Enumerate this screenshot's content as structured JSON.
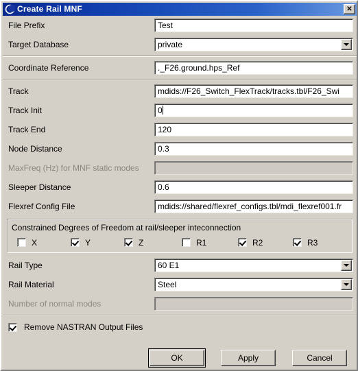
{
  "window": {
    "title": "Create Rail MNF",
    "icon": "moon-icon",
    "close_label": "✕",
    "close_icon": "close-icon"
  },
  "form": {
    "groups": [
      {
        "rows": [
          {
            "label": "File Prefix",
            "type": "text",
            "value": "Test",
            "disabled": false,
            "focused": false
          },
          {
            "label": "Target Database",
            "type": "combo",
            "value": "private",
            "disabled": false
          }
        ]
      },
      {
        "rows": [
          {
            "label": "Coordinate Reference",
            "type": "text",
            "value": "._F26.ground.hps_Ref",
            "disabled": false,
            "focused": false
          }
        ]
      },
      {
        "rows": [
          {
            "label": "Track",
            "type": "text",
            "value": "mdids://F26_Switch_FlexTrack/tracks.tbl/F26_Swi",
            "disabled": false,
            "focused": false
          },
          {
            "label": "Track Init",
            "type": "text",
            "value": "0",
            "disabled": false,
            "focused": true
          },
          {
            "label": "Track End",
            "type": "text",
            "value": "120",
            "disabled": false,
            "focused": false
          },
          {
            "label": "Node Distance",
            "type": "text",
            "value": "0.3",
            "disabled": false,
            "focused": false
          },
          {
            "label": "MaxFreq (Hz) for MNF static modes",
            "type": "text",
            "value": "",
            "disabled": true,
            "focused": false
          },
          {
            "label": "Sleeper Distance",
            "type": "text",
            "value": "0.6",
            "disabled": false,
            "focused": false
          },
          {
            "label": "Flexref Config File",
            "type": "text",
            "value": "mdids://shared/flexref_configs.tbl/mdi_flexref001.fr",
            "disabled": false,
            "focused": false
          }
        ]
      }
    ]
  },
  "constrained_dof": {
    "title": "Constrained Degrees of Freedom at rail/sleeper inteconnection",
    "items": [
      {
        "label": "X",
        "checked": false
      },
      {
        "label": "Y",
        "checked": true
      },
      {
        "label": "Z",
        "checked": true
      },
      {
        "label": "R1",
        "checked": false
      },
      {
        "label": "R2",
        "checked": true
      },
      {
        "label": "R3",
        "checked": true
      }
    ]
  },
  "form_bottom": {
    "rows": [
      {
        "label": "Rail Type",
        "type": "combo",
        "value": "60 E1",
        "disabled": false
      },
      {
        "label": "Rail Material",
        "type": "combo",
        "value": "Steel",
        "disabled": false
      },
      {
        "label": "Number of normal modes",
        "type": "text",
        "value": "",
        "disabled": true,
        "focused": false
      }
    ]
  },
  "remove_nastran": {
    "label": "Remove NASTRAN Output Files",
    "checked": true
  },
  "buttons": [
    {
      "label": "OK",
      "name": "ok-button",
      "default": true
    },
    {
      "label": "Apply",
      "name": "apply-button",
      "default": false
    },
    {
      "label": "Cancel",
      "name": "cancel-button",
      "default": false
    }
  ],
  "colors": {
    "face": "#d4d0c8",
    "title_start": "#0a2a8f",
    "title_end": "#6a9ae0",
    "field_bg": "#ffffff",
    "disabled_bg": "#cfcbc4"
  }
}
